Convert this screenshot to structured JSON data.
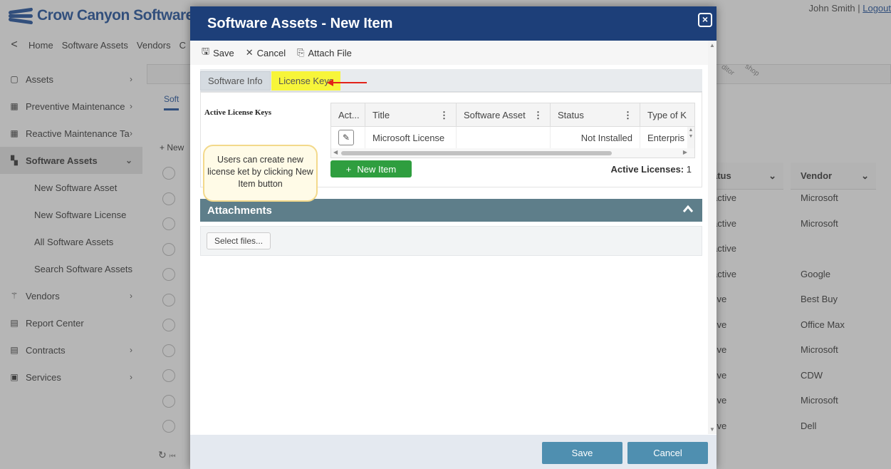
{
  "app": {
    "logo_text": "Crow Canyon Software",
    "user_name": "John Smith",
    "separator": "|",
    "logout_label": "Logout",
    "nav_back": "<",
    "nav_links": [
      "Home",
      "Software Assets",
      "Vendors",
      "C"
    ]
  },
  "sidebar": {
    "items": [
      {
        "label": "Assets",
        "icon": "assets-icon",
        "glyph": "▢"
      },
      {
        "label": "Preventive Maintenance",
        "icon": "calendar-icon",
        "glyph": "▦"
      },
      {
        "label": "Reactive Maintenance Ta",
        "icon": "calendar-icon",
        "glyph": "▦"
      },
      {
        "label": "Software Assets",
        "icon": "windows-icon",
        "glyph": "▚"
      },
      {
        "label": "Vendors",
        "icon": "vendors-icon",
        "glyph": "⚚"
      },
      {
        "label": "Report Center",
        "icon": "report-icon",
        "glyph": "▤"
      },
      {
        "label": "Contracts",
        "icon": "contract-icon",
        "glyph": "▤"
      },
      {
        "label": "Services",
        "icon": "services-icon",
        "glyph": "▣"
      }
    ],
    "sub_items": [
      "New Software Asset",
      "New Software License",
      "All Software Assets",
      "Search Software Assets"
    ]
  },
  "background": {
    "tab_label": "Soft",
    "new_label": "+ New",
    "tilted_labels": [
      "ditor",
      "shop"
    ],
    "status_header": "atus",
    "vendor_header": "Vendor",
    "status_values": [
      "active",
      "active",
      "active",
      "active",
      "tive",
      "tive",
      "tive",
      "tive",
      "tive",
      "tive"
    ],
    "vendor_values": [
      "Microsoft",
      "Microsoft",
      "",
      "Google",
      "Best Buy",
      "Office Max",
      "Microsoft",
      "CDW",
      "Microsoft",
      "Dell"
    ]
  },
  "modal": {
    "title": "Software Assets - New Item",
    "close_glyph": "×",
    "toolbar": {
      "save_label": "Save",
      "cancel_label": "Cancel",
      "attach_label": "Attach File"
    },
    "tabs": {
      "info_label": "Software Info",
      "keys_label": "License Keys"
    },
    "license_keys": {
      "section_title": "Active License Keys",
      "columns": [
        "Act...",
        "Title",
        "Software Asset",
        "Status",
        "Type of K"
      ],
      "rows": [
        {
          "title": "Microsoft License",
          "software_asset": "",
          "status": "Not Installed",
          "type": "Enterpris"
        }
      ],
      "new_item_label": "New Item",
      "active_count_label": "Active Licenses:",
      "active_count": "1"
    },
    "callout_text": "Users can create new license ket by clicking New Item button",
    "attachments": {
      "title": "Attachments",
      "select_label": "Select files..."
    },
    "footer": {
      "save_label": "Save",
      "cancel_label": "Cancel"
    }
  },
  "colors": {
    "title_bar": "#1d3f79",
    "highlight_tab": "#f7f53a",
    "new_item_button": "#2f9e3f",
    "attachments_header": "#5e7e8a",
    "footer_button": "#4f8fb0",
    "arrow": "#e2231a"
  }
}
